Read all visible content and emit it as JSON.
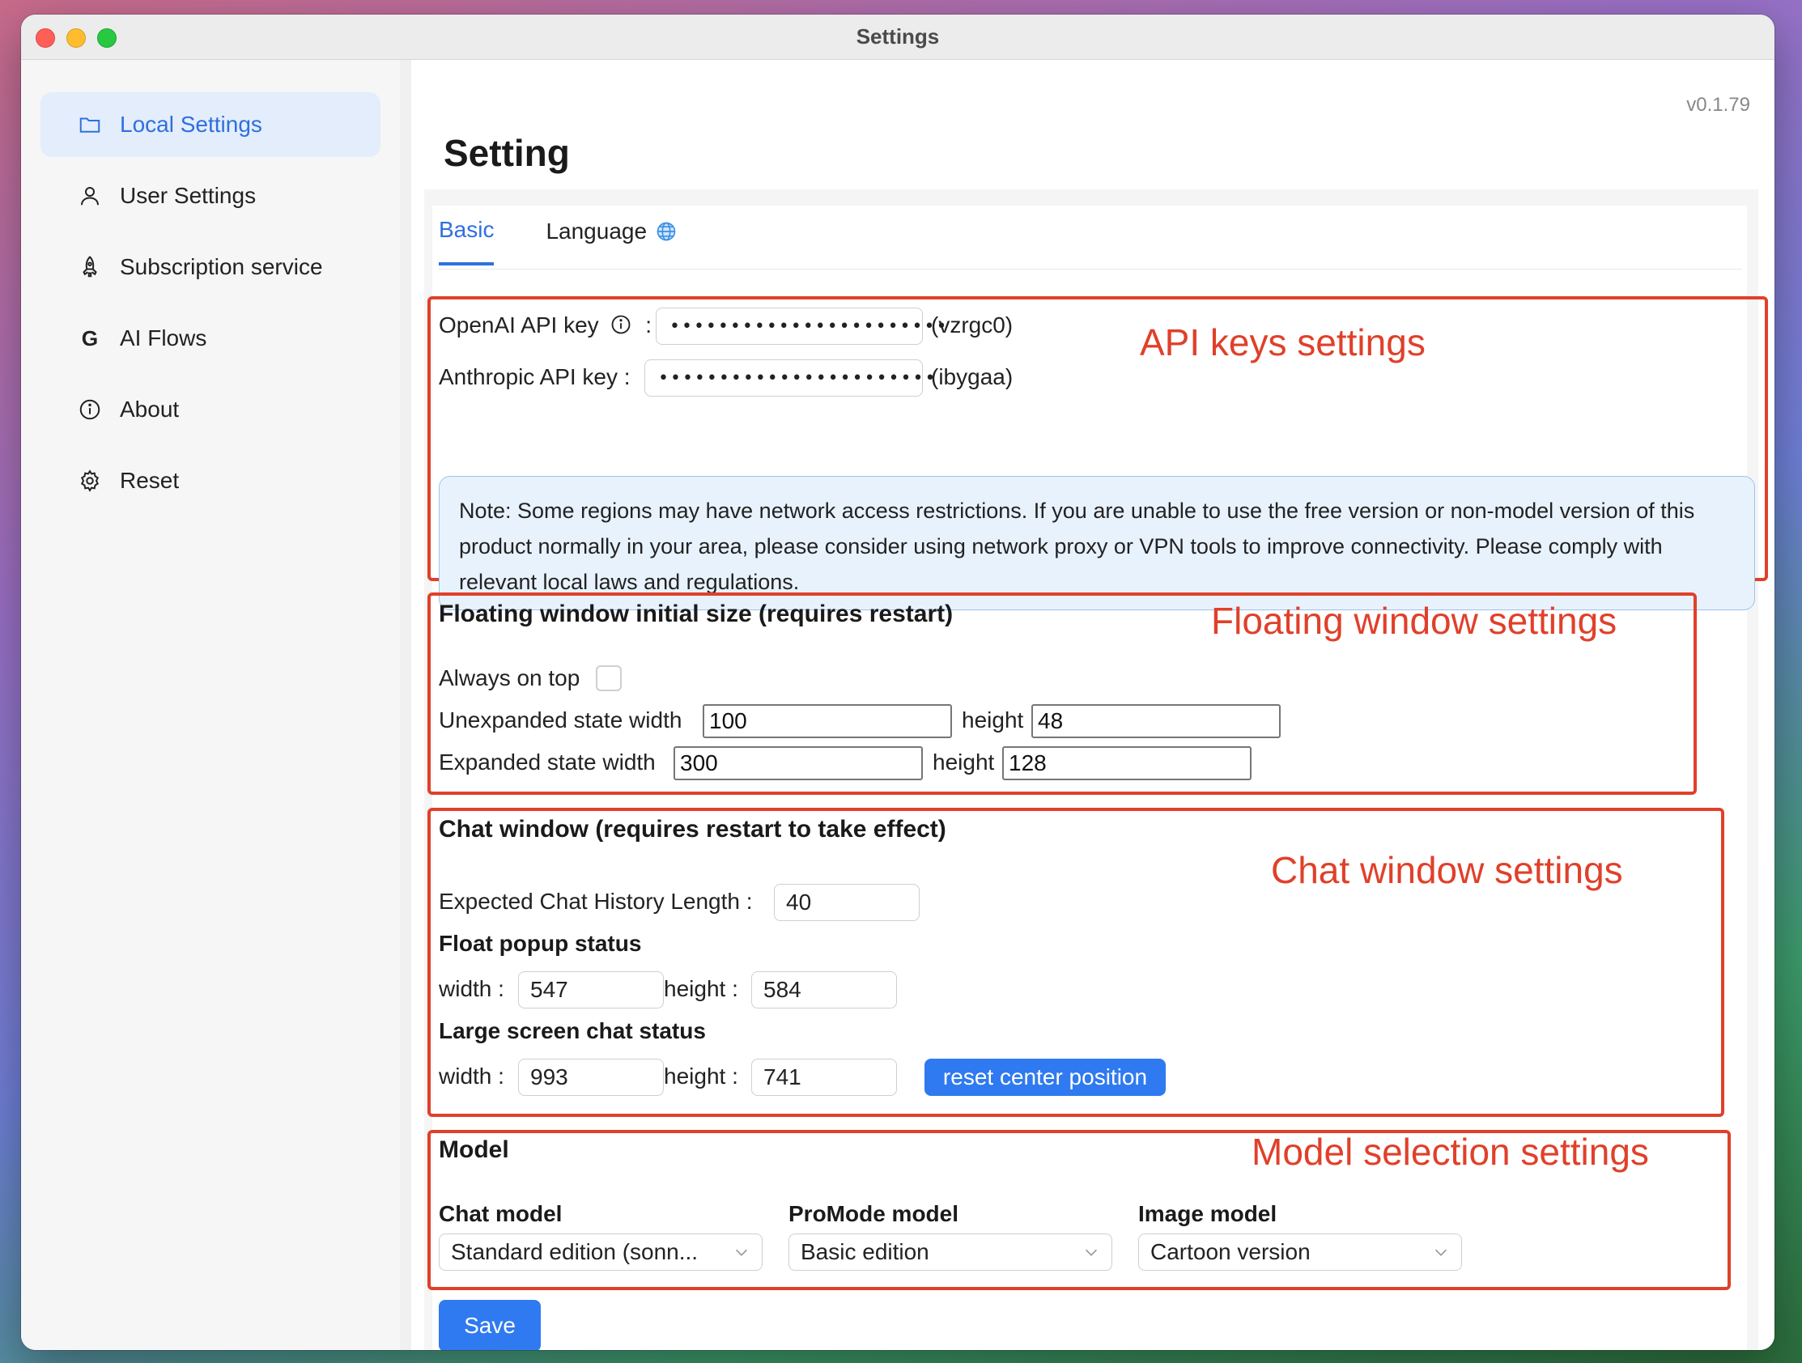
{
  "window": {
    "title": "Settings"
  },
  "sidebar": {
    "items": [
      {
        "label": "Local Settings",
        "icon": "folder-icon",
        "active": true
      },
      {
        "label": "User Settings",
        "icon": "user-icon"
      },
      {
        "label": "Subscription service",
        "icon": "rocket-icon"
      },
      {
        "label": "AI Flows",
        "icon": "g-logo-icon"
      },
      {
        "label": "About",
        "icon": "info-icon"
      },
      {
        "label": "Reset",
        "icon": "gear-icon"
      }
    ]
  },
  "header": {
    "version": "v0.1.79",
    "title": "Setting"
  },
  "tabs": [
    {
      "label": "Basic",
      "active": true
    },
    {
      "label": "Language",
      "icon": "globe-icon"
    }
  ],
  "api": {
    "openai_label": "OpenAI API key",
    "openai_colon": ":",
    "openai_value": "•••••••••••••••••••••••",
    "openai_suffix": "(vzrgc0)",
    "anthropic_label": "Anthropic API key",
    "anthropic_colon": ":",
    "anthropic_value": "•••••••••••••••••••••••",
    "anthropic_suffix": "(ibygaa)",
    "note": "Note: Some regions may have network access restrictions. If you are unable to use the free version or non-model version of this product normally in your area, please consider using network proxy or VPN tools to improve connectivity. Please comply with relevant local laws and regulations."
  },
  "floating": {
    "title": "Floating window initial size (requires restart)",
    "always_on_top": "Always on top",
    "always_on_top_checked": false,
    "unexpanded_label": "Unexpanded state  width",
    "unexpanded_width": "100",
    "unexpanded_height_label": "height",
    "unexpanded_height": "48",
    "expanded_label": "Expanded state  width",
    "expanded_width": "300",
    "expanded_height_label": "height",
    "expanded_height": "128"
  },
  "chat": {
    "title": "Chat window (requires restart to take effect)",
    "history_label": "Expected Chat History Length",
    "history_colon": ":",
    "history_value": "40",
    "float_popup_title": "Float popup status",
    "width_label": "width",
    "height_label": "height",
    "colon": ":",
    "float_width": "547",
    "float_height": "584",
    "large_title": "Large screen chat status",
    "large_width": "993",
    "large_height": "741",
    "reset_button": "reset center position"
  },
  "model": {
    "title": "Model",
    "chat_label": "Chat model",
    "chat_value": "Standard edition (sonn...",
    "promode_label": "ProMode model",
    "promode_value": "Basic edition",
    "image_label": "Image model",
    "image_value": "Cartoon version"
  },
  "save_button": "Save",
  "annotations": {
    "api": "API keys settings",
    "floating": "Floating window settings",
    "chat": "Chat window settings",
    "model": "Model selection settings"
  },
  "colors": {
    "accent": "#2f6fdf",
    "annotation_red": "#e0402a",
    "primary_button": "#2f7af0",
    "note_bg": "#e8f2fc"
  }
}
